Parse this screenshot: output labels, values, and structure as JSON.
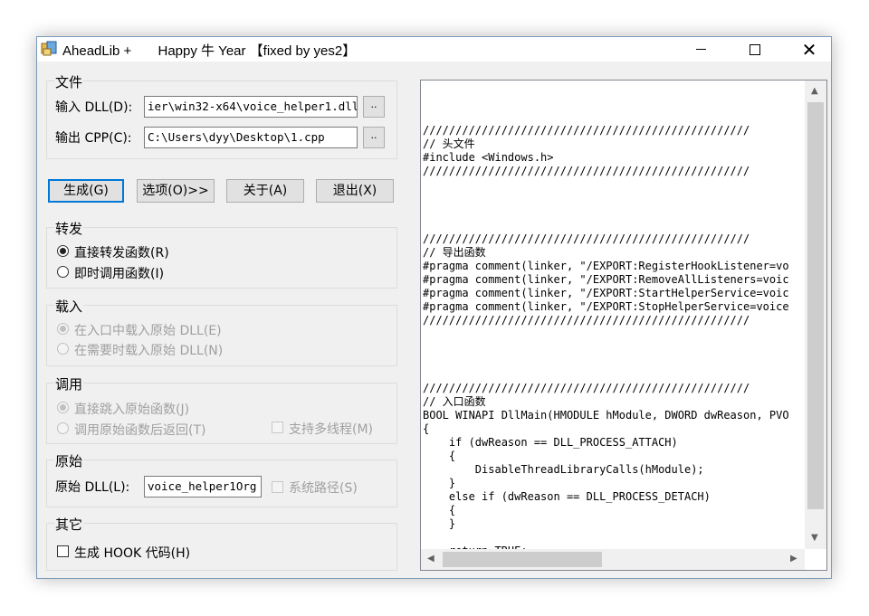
{
  "window": {
    "title": "AheadLib +       Happy 牛 Year 【fixed by yes2】",
    "controls": {
      "minimize": "minimize",
      "maximize": "maximize",
      "close": "✕"
    }
  },
  "files": {
    "group_title": "文件",
    "input_label": "输入 DLL(D):",
    "input_value": "ier\\win32-x64\\voice_helper1.dll",
    "output_label": "输出 CPP(C):",
    "output_value": "C:\\Users\\dyy\\Desktop\\1.cpp",
    "browse_label": ".."
  },
  "actions": {
    "generate": "生成(G)",
    "options": "选项(O)>>",
    "about": "关于(A)",
    "exit": "退出(X)"
  },
  "forward": {
    "group_title": "转发",
    "direct": "直接转发函数(R)",
    "instant": "即时调用函数(I)"
  },
  "load": {
    "group_title": "载入",
    "on_entry": "在入口中载入原始 DLL(E)",
    "on_demand": "在需要时载入原始 DLL(N)"
  },
  "call": {
    "group_title": "调用",
    "jump": "直接跳入原始函数(J)",
    "call_return": "调用原始函数后返回(T)",
    "multithread": "支持多线程(M)"
  },
  "original": {
    "group_title": "原始",
    "dll_label": "原始 DLL(L):",
    "dll_value": "voice_helper1Org",
    "system_path": "系统路径(S)"
  },
  "other": {
    "group_title": "其它",
    "hook": "生成 HOOK 代码(H)"
  },
  "code": "//////////////////////////////////////////////////\n// 头文件\n#include <Windows.h>\n//////////////////////////////////////////////////\n\n\n\n\n//////////////////////////////////////////////////\n// 导出函数\n#pragma comment(linker, \"/EXPORT:RegisterHookListener=vo\n#pragma comment(linker, \"/EXPORT:RemoveAllListeners=voic\n#pragma comment(linker, \"/EXPORT:StartHelperService=voic\n#pragma comment(linker, \"/EXPORT:StopHelperService=voice\n//////////////////////////////////////////////////\n\n\n\n\n//////////////////////////////////////////////////\n// 入口函数\nBOOL WINAPI DllMain(HMODULE hModule, DWORD dwReason, PVO\n{\n    if (dwReason == DLL_PROCESS_ATTACH)\n    {\n        DisableThreadLibraryCalls(hModule);\n    }\n    else if (dwReason == DLL_PROCESS_DETACH)\n    {\n    }\n\n    return TRUE;\n}\n//////////////////////////////////////////////////"
}
